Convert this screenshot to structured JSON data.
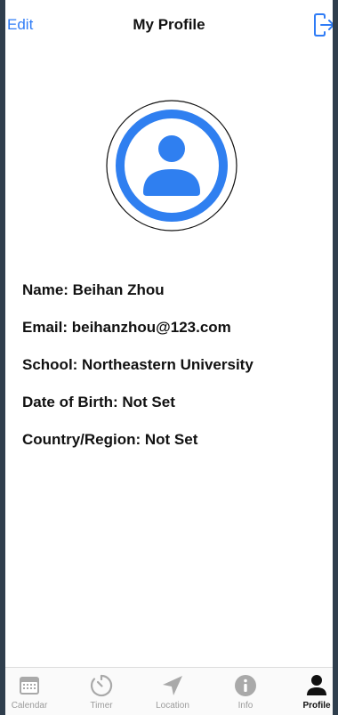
{
  "nav": {
    "edit_label": "Edit",
    "title": "My Profile",
    "logout_icon": "logout-icon"
  },
  "profile": {
    "avatar_icon": "person-icon",
    "fields": [
      "Name: Beihan Zhou",
      "Email: beihanzhou@123.com",
      "School: Northeastern University",
      "Date of Birth: Not Set",
      "Country/Region: Not Set"
    ]
  },
  "tabs": [
    {
      "label": "Calendar",
      "icon": "calendar-icon",
      "active": false
    },
    {
      "label": "Timer",
      "icon": "timer-icon",
      "active": false
    },
    {
      "label": "Location",
      "icon": "location-arrow-icon",
      "active": false
    },
    {
      "label": "Info",
      "icon": "info-icon",
      "active": false
    },
    {
      "label": "Profile",
      "icon": "person-icon",
      "active": true
    }
  ],
  "colors": {
    "accent": "#2f7cf6",
    "avatar_blue": "#2f7ff0",
    "inactive_tab": "#9b9b9b",
    "active_tab": "#111111"
  }
}
